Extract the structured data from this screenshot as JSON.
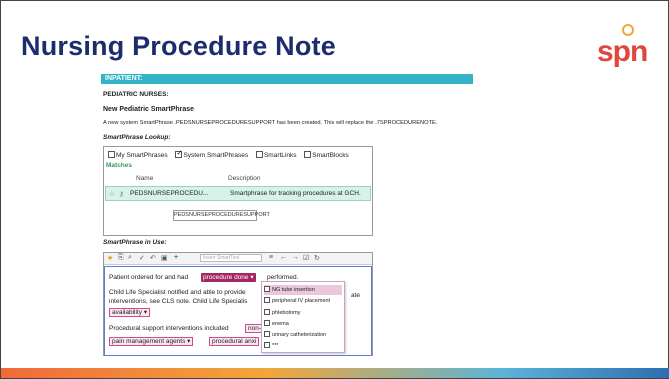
{
  "slide": {
    "title": "Nursing Procedure Note",
    "logo_text": "spn",
    "colors": {
      "title": "#1c2d6e",
      "logo": "#e0463c",
      "banner": "#32b3c6",
      "tag": "#a3285f"
    }
  },
  "doc": {
    "banner": "INPATIENT:",
    "section": "PEDIATRIC NURSES:",
    "heading": "New Pediatric SmartPhrase",
    "description": "A new system SmartPhrase .PEDSNURSEPROCEDURESUPPORT has been created. This will replace the .7SPROCEDURENOTE.",
    "lookup_label": "SmartPhrase Lookup:",
    "inuse_label": "SmartPhrase in Use:"
  },
  "lookup": {
    "checkboxes": [
      {
        "label": "My SmartPhrases",
        "checked": false
      },
      {
        "label": "System SmartPhrases",
        "checked": true
      },
      {
        "label": "SmartLinks",
        "checked": false
      },
      {
        "label": "SmartBlocks",
        "checked": false
      }
    ],
    "matches_label": "Matches",
    "columns": [
      "Name",
      "Description"
    ],
    "row": {
      "name": "PEDSNURSEPROCEDU...",
      "description": "Smartphrase for tracking procedures at GCH."
    },
    "button": "PEDSNURSEPROCEDURESUPPORT"
  },
  "editor": {
    "toolbar_placeholder": "Insert SmartText",
    "line1_pre": "Patient ordered for and had",
    "line1_tag": "procedure done",
    "line1_post": "performed.",
    "line2": "Child Life Specialist notified and able to provide",
    "line2_tail": "ate",
    "line3": "interventions, see CLS note. Child Life Specialis",
    "line4_tag": "availability",
    "line5": "Procedural support interventions included",
    "line5_tag": "non-",
    "line6_tag1": "pain management agents",
    "line6_tag2": "procedural anxi"
  },
  "dropdown": {
    "items": [
      {
        "label": "NG tube insertion",
        "selected": true
      },
      {
        "label": "peripheral IV placement",
        "selected": false
      },
      {
        "label": "phlebotomy",
        "selected": false
      },
      {
        "label": "enema",
        "selected": false
      },
      {
        "label": "urinary catheterization",
        "selected": false
      },
      {
        "label": "***",
        "selected": false
      }
    ]
  }
}
